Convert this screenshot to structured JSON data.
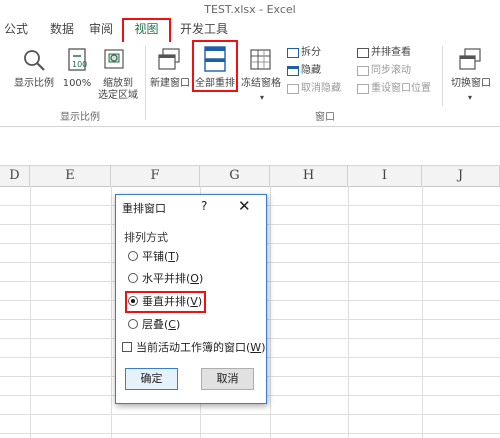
{
  "window": {
    "title": "TEST.xlsx - Excel"
  },
  "tabs": [
    "公式",
    "数据",
    "审阅",
    "视图",
    "开发工具"
  ],
  "ribbon": {
    "zoom_label": "显示比例",
    "zoom100_label": "100%",
    "zoom_sel_label_1": "缩放到",
    "zoom_sel_label_2": "选定区域",
    "group_zoom": "显示比例",
    "new_window_label": "新建窗口",
    "arrange_all_label": "全部重排",
    "freeze_label": "冻结窗格",
    "split_label": "拆分",
    "hide_label": "隐藏",
    "unhide_label": "取消隐藏",
    "side_by_side_label": "并排查看",
    "sync_scroll_label": "同步滚动",
    "reset_pos_label": "重设窗口位置",
    "switch_label": "切换窗口",
    "group_window": "窗口"
  },
  "columns": [
    "D",
    "E",
    "F",
    "G",
    "H",
    "I",
    "J"
  ],
  "dialog": {
    "title": "重排窗口",
    "help": "?",
    "close": "✕",
    "section": "排列方式",
    "options": [
      {
        "label": "平铺",
        "key": "T",
        "selected": false
      },
      {
        "label": "水平并排",
        "key": "O",
        "selected": false
      },
      {
        "label": "垂直并排",
        "key": "V",
        "selected": true
      },
      {
        "label": "层叠",
        "key": "C",
        "selected": false
      }
    ],
    "checkbox_label": "当前活动工作簿的窗口",
    "checkbox_key": "W",
    "ok": "确定",
    "cancel": "取消"
  },
  "colors": {
    "highlight": "#ee1111",
    "excel_green": "#217346",
    "dialog_border": "#3a7dd0"
  }
}
